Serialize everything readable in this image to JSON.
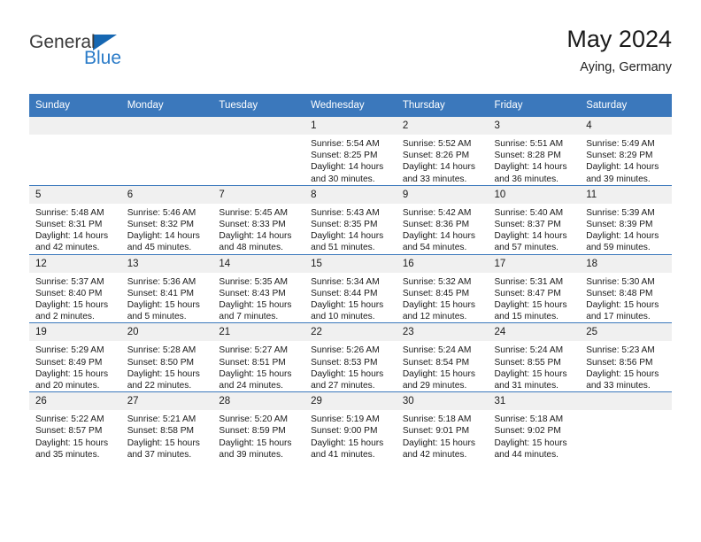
{
  "brand": {
    "name_part1": "General",
    "name_part2": "Blue",
    "triangle_color": "#1667b2",
    "text_color": "#3b3b3b",
    "blue_color": "#2a7bc8"
  },
  "header": {
    "title": "May 2024",
    "subtitle": "Aying, Germany"
  },
  "theme": {
    "header_bg": "#3b78bc",
    "row_divider": "#3b78bc",
    "daynum_bg": "#f0f0f0"
  },
  "weekdays": [
    "Sunday",
    "Monday",
    "Tuesday",
    "Wednesday",
    "Thursday",
    "Friday",
    "Saturday"
  ],
  "weeks": [
    [
      {
        "day": "",
        "sunrise": "",
        "sunset": "",
        "daylight_line1": "",
        "daylight_line2": ""
      },
      {
        "day": "",
        "sunrise": "",
        "sunset": "",
        "daylight_line1": "",
        "daylight_line2": ""
      },
      {
        "day": "",
        "sunrise": "",
        "sunset": "",
        "daylight_line1": "",
        "daylight_line2": ""
      },
      {
        "day": "1",
        "sunrise": "Sunrise: 5:54 AM",
        "sunset": "Sunset: 8:25 PM",
        "daylight_line1": "Daylight: 14 hours",
        "daylight_line2": "and 30 minutes."
      },
      {
        "day": "2",
        "sunrise": "Sunrise: 5:52 AM",
        "sunset": "Sunset: 8:26 PM",
        "daylight_line1": "Daylight: 14 hours",
        "daylight_line2": "and 33 minutes."
      },
      {
        "day": "3",
        "sunrise": "Sunrise: 5:51 AM",
        "sunset": "Sunset: 8:28 PM",
        "daylight_line1": "Daylight: 14 hours",
        "daylight_line2": "and 36 minutes."
      },
      {
        "day": "4",
        "sunrise": "Sunrise: 5:49 AM",
        "sunset": "Sunset: 8:29 PM",
        "daylight_line1": "Daylight: 14 hours",
        "daylight_line2": "and 39 minutes."
      }
    ],
    [
      {
        "day": "5",
        "sunrise": "Sunrise: 5:48 AM",
        "sunset": "Sunset: 8:31 PM",
        "daylight_line1": "Daylight: 14 hours",
        "daylight_line2": "and 42 minutes."
      },
      {
        "day": "6",
        "sunrise": "Sunrise: 5:46 AM",
        "sunset": "Sunset: 8:32 PM",
        "daylight_line1": "Daylight: 14 hours",
        "daylight_line2": "and 45 minutes."
      },
      {
        "day": "7",
        "sunrise": "Sunrise: 5:45 AM",
        "sunset": "Sunset: 8:33 PM",
        "daylight_line1": "Daylight: 14 hours",
        "daylight_line2": "and 48 minutes."
      },
      {
        "day": "8",
        "sunrise": "Sunrise: 5:43 AM",
        "sunset": "Sunset: 8:35 PM",
        "daylight_line1": "Daylight: 14 hours",
        "daylight_line2": "and 51 minutes."
      },
      {
        "day": "9",
        "sunrise": "Sunrise: 5:42 AM",
        "sunset": "Sunset: 8:36 PM",
        "daylight_line1": "Daylight: 14 hours",
        "daylight_line2": "and 54 minutes."
      },
      {
        "day": "10",
        "sunrise": "Sunrise: 5:40 AM",
        "sunset": "Sunset: 8:37 PM",
        "daylight_line1": "Daylight: 14 hours",
        "daylight_line2": "and 57 minutes."
      },
      {
        "day": "11",
        "sunrise": "Sunrise: 5:39 AM",
        "sunset": "Sunset: 8:39 PM",
        "daylight_line1": "Daylight: 14 hours",
        "daylight_line2": "and 59 minutes."
      }
    ],
    [
      {
        "day": "12",
        "sunrise": "Sunrise: 5:37 AM",
        "sunset": "Sunset: 8:40 PM",
        "daylight_line1": "Daylight: 15 hours",
        "daylight_line2": "and 2 minutes."
      },
      {
        "day": "13",
        "sunrise": "Sunrise: 5:36 AM",
        "sunset": "Sunset: 8:41 PM",
        "daylight_line1": "Daylight: 15 hours",
        "daylight_line2": "and 5 minutes."
      },
      {
        "day": "14",
        "sunrise": "Sunrise: 5:35 AM",
        "sunset": "Sunset: 8:43 PM",
        "daylight_line1": "Daylight: 15 hours",
        "daylight_line2": "and 7 minutes."
      },
      {
        "day": "15",
        "sunrise": "Sunrise: 5:34 AM",
        "sunset": "Sunset: 8:44 PM",
        "daylight_line1": "Daylight: 15 hours",
        "daylight_line2": "and 10 minutes."
      },
      {
        "day": "16",
        "sunrise": "Sunrise: 5:32 AM",
        "sunset": "Sunset: 8:45 PM",
        "daylight_line1": "Daylight: 15 hours",
        "daylight_line2": "and 12 minutes."
      },
      {
        "day": "17",
        "sunrise": "Sunrise: 5:31 AM",
        "sunset": "Sunset: 8:47 PM",
        "daylight_line1": "Daylight: 15 hours",
        "daylight_line2": "and 15 minutes."
      },
      {
        "day": "18",
        "sunrise": "Sunrise: 5:30 AM",
        "sunset": "Sunset: 8:48 PM",
        "daylight_line1": "Daylight: 15 hours",
        "daylight_line2": "and 17 minutes."
      }
    ],
    [
      {
        "day": "19",
        "sunrise": "Sunrise: 5:29 AM",
        "sunset": "Sunset: 8:49 PM",
        "daylight_line1": "Daylight: 15 hours",
        "daylight_line2": "and 20 minutes."
      },
      {
        "day": "20",
        "sunrise": "Sunrise: 5:28 AM",
        "sunset": "Sunset: 8:50 PM",
        "daylight_line1": "Daylight: 15 hours",
        "daylight_line2": "and 22 minutes."
      },
      {
        "day": "21",
        "sunrise": "Sunrise: 5:27 AM",
        "sunset": "Sunset: 8:51 PM",
        "daylight_line1": "Daylight: 15 hours",
        "daylight_line2": "and 24 minutes."
      },
      {
        "day": "22",
        "sunrise": "Sunrise: 5:26 AM",
        "sunset": "Sunset: 8:53 PM",
        "daylight_line1": "Daylight: 15 hours",
        "daylight_line2": "and 27 minutes."
      },
      {
        "day": "23",
        "sunrise": "Sunrise: 5:24 AM",
        "sunset": "Sunset: 8:54 PM",
        "daylight_line1": "Daylight: 15 hours",
        "daylight_line2": "and 29 minutes."
      },
      {
        "day": "24",
        "sunrise": "Sunrise: 5:24 AM",
        "sunset": "Sunset: 8:55 PM",
        "daylight_line1": "Daylight: 15 hours",
        "daylight_line2": "and 31 minutes."
      },
      {
        "day": "25",
        "sunrise": "Sunrise: 5:23 AM",
        "sunset": "Sunset: 8:56 PM",
        "daylight_line1": "Daylight: 15 hours",
        "daylight_line2": "and 33 minutes."
      }
    ],
    [
      {
        "day": "26",
        "sunrise": "Sunrise: 5:22 AM",
        "sunset": "Sunset: 8:57 PM",
        "daylight_line1": "Daylight: 15 hours",
        "daylight_line2": "and 35 minutes."
      },
      {
        "day": "27",
        "sunrise": "Sunrise: 5:21 AM",
        "sunset": "Sunset: 8:58 PM",
        "daylight_line1": "Daylight: 15 hours",
        "daylight_line2": "and 37 minutes."
      },
      {
        "day": "28",
        "sunrise": "Sunrise: 5:20 AM",
        "sunset": "Sunset: 8:59 PM",
        "daylight_line1": "Daylight: 15 hours",
        "daylight_line2": "and 39 minutes."
      },
      {
        "day": "29",
        "sunrise": "Sunrise: 5:19 AM",
        "sunset": "Sunset: 9:00 PM",
        "daylight_line1": "Daylight: 15 hours",
        "daylight_line2": "and 41 minutes."
      },
      {
        "day": "30",
        "sunrise": "Sunrise: 5:18 AM",
        "sunset": "Sunset: 9:01 PM",
        "daylight_line1": "Daylight: 15 hours",
        "daylight_line2": "and 42 minutes."
      },
      {
        "day": "31",
        "sunrise": "Sunrise: 5:18 AM",
        "sunset": "Sunset: 9:02 PM",
        "daylight_line1": "Daylight: 15 hours",
        "daylight_line2": "and 44 minutes."
      },
      {
        "day": "",
        "sunrise": "",
        "sunset": "",
        "daylight_line1": "",
        "daylight_line2": ""
      }
    ]
  ]
}
